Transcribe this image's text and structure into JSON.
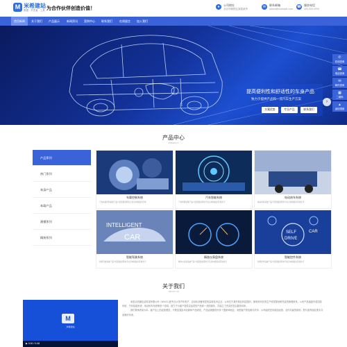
{
  "header": {
    "logo_mark": "M",
    "logo_name": "米希建站",
    "logo_sub": "数据 · 开发者 · 工具",
    "slogan": "为合作伙伴创造价值！",
    "contacts": [
      {
        "icon": "map-pin-icon",
        "line1": "公司地址",
        "line2": "北京市朝阳区某路某号"
      },
      {
        "icon": "mail-icon",
        "line1": "联系邮箱",
        "line2": "admin@example.com"
      },
      {
        "icon": "phone-icon",
        "line1": "服务电话",
        "line2": "400-000-0000"
      }
    ]
  },
  "nav": {
    "items": [
      "首页新闻",
      "关于我们",
      "产品展示",
      "新闻资讯",
      "案例中心",
      "联系我们",
      "在线留言",
      "加入我们"
    ]
  },
  "banner": {
    "title": "提高便利性和舒适性的车身产品",
    "subtitle": "致力于提供产品和一流汽车生产方案",
    "buttons": [
      "方案优势",
      "专业产品",
      "联系我们"
    ],
    "prev": "‹",
    "next": "›"
  },
  "side_float": [
    {
      "icon": "chat-icon",
      "label": "在线咨询"
    },
    {
      "icon": "phone-icon",
      "label": "电话咨询"
    },
    {
      "icon": "mail-icon",
      "label": "邮件咨询"
    },
    {
      "icon": "qrcode-icon",
      "label": "二维码"
    },
    {
      "icon": "arrow-up-icon",
      "label": "返回顶部"
    }
  ],
  "products": {
    "title": "产品中心",
    "subtitle": "PRODUCT",
    "categories": [
      "产品系列",
      "热门系列",
      "车身产品",
      "车载产品",
      "建模系列",
      "精装系列"
    ],
    "cards": [
      {
        "title": "车载控制系统",
        "desc": "汽车车载控制系统产品介绍简要说明文字信息内容展示区域"
      },
      {
        "title": "汽车智能系统",
        "desc": "汽车智能系统产品介绍简要说明文字信息内容展示区域文字"
      },
      {
        "title": "电动刹车系统",
        "desc": "电动刹车系统产品介绍简要说明文字信息内容展示区域文字"
      },
      {
        "title": "智能驾驶系统",
        "desc": "智能驾驶系统产品介绍简要说明文字信息内容展示区域文字"
      },
      {
        "title": "精准仪表盘系统",
        "desc": "精准仪表盘系统产品介绍简要说明文字信息内容展示区域文字"
      },
      {
        "title": "智能控件系统",
        "desc": "智能控件系统产品介绍简要说明文字信息内容展示区域文字"
      }
    ],
    "card_labels": {
      "intel": "INTELLIGENT",
      "car": "CAR",
      "self": "SELF",
      "drive": "DRIVE"
    }
  },
  "about": {
    "title": "关于我们",
    "subtitle": "ABOUT US",
    "video_logo": "M",
    "video_name": "米希建站",
    "video_time": "0:00 / 0:48",
    "paragraphs": [
      "米盈点机器信息科技有限公司（MINGL)是专业从事汽车电子、自动化设备研发的高新技术企业，公司位于某市某区科技园内，拥有现代化的生产研发基地和完善的管理体系。公司产品涵盖车载控制系统、汽车智能系统、电动刹车系统等多个领域，致力于为客户提供高品质的产品和一流的服务，并建立了完善的售后服务体系。",
      "我们秉承质量为本，客户至上的经营理念，不断加强技术创新和产品研发，产品远销国内外多个国家和地区，深受客户的信赖与好评。公司始终坚持诚信经营、合作共赢的原则，愿与各界朋友携手共创美好未来。"
    ]
  }
}
